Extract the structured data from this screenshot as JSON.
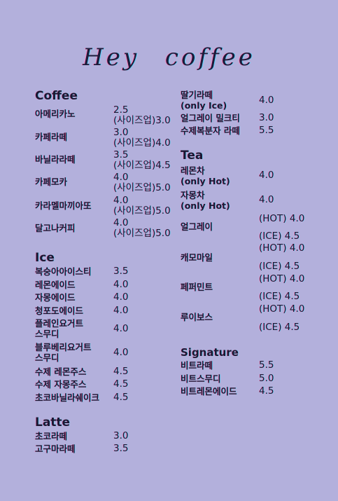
{
  "title": "Hey coffee",
  "coffee": {
    "heading": "Coffee",
    "items": [
      {
        "name": "아메리카노",
        "p1": "2.5",
        "p2": "(사이즈업)3.0"
      },
      {
        "name": "카페라떼",
        "p1": "3.0",
        "p2": "(사이즈업)4.0"
      },
      {
        "name": "바닐라라떼",
        "p1": "3.5",
        "p2": "(사이즈업)4.5"
      },
      {
        "name": "카페모카",
        "p1": "4.0",
        "p2": "(사이즈업)5.0"
      },
      {
        "name": "카라멜마끼아또",
        "p1": "4.0",
        "p2": "(사이즈업)5.0"
      },
      {
        "name": "달고나커피",
        "p1": "4.0",
        "p2": "(사이즈업)5.0"
      }
    ]
  },
  "ice": {
    "heading": "Ice",
    "items": [
      {
        "name": "복숭아아이스티",
        "price": "3.5"
      },
      {
        "name": "레몬에이드",
        "price": "4.0"
      },
      {
        "name": "자몽에이드",
        "price": "4.0"
      },
      {
        "name": "청포도에이드",
        "price": "4.0"
      },
      {
        "name": "플레인요거트\n스무디",
        "price": "4.0"
      },
      {
        "name": "블루베리요거트\n스무디",
        "price": "4.0"
      },
      {
        "name": "수제 레몬주스",
        "price": "4.5"
      },
      {
        "name": "수제 자몽주스",
        "price": "4.5"
      },
      {
        "name": "초코바닐라쉐이크",
        "price": "4.5"
      }
    ]
  },
  "latte": {
    "heading": "Latte",
    "items": [
      {
        "name": "초코라떼",
        "price": "3.0"
      },
      {
        "name": "고구마라떼",
        "price": "3.5"
      }
    ]
  },
  "right_top": {
    "items": [
      {
        "name": "딸기라떼\n(only Ice)",
        "price": "4.0"
      },
      {
        "name": "얼그레이 밀크티",
        "price": "3.0"
      },
      {
        "name": "수제복분자 라떼",
        "price": "5.5"
      }
    ]
  },
  "tea": {
    "heading": "Tea",
    "items": [
      {
        "name": "레몬차\n(only Hot)",
        "price": "4.0"
      },
      {
        "name": "자몽차\n(only Hot)",
        "price": "4.0"
      },
      {
        "name": "얼그레이",
        "hot": "(HOT) 4.0",
        "ice": "(ICE) 4.5"
      },
      {
        "name": "캐모마일",
        "hot": "(HOT) 4.0",
        "ice": "(ICE) 4.5"
      },
      {
        "name": "페퍼민트",
        "hot": "(HOT) 4.0",
        "ice": "(ICE) 4.5"
      },
      {
        "name": "루이보스",
        "hot": "(HOT) 4.0",
        "ice": "(ICE) 4.5"
      }
    ]
  },
  "signature": {
    "heading": "Signature",
    "items": [
      {
        "name": "비트라떼",
        "price": "5.5"
      },
      {
        "name": "비트스무디",
        "price": "5.0"
      },
      {
        "name": "비트레몬에이드",
        "price": "4.5"
      }
    ]
  }
}
